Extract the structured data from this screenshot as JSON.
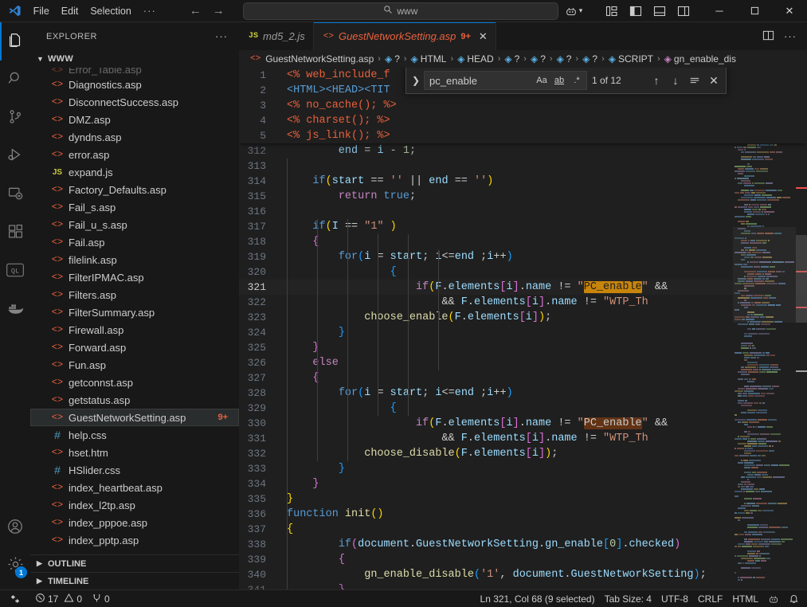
{
  "titlebar": {
    "menus": [
      "File",
      "Edit",
      "Selection"
    ],
    "more_label": "···",
    "back_icon": "arrow-left-icon",
    "forward_icon": "arrow-right-icon",
    "search_value": "www",
    "search_icon": "search-icon",
    "accounts_icon": "remote-explorer-icon",
    "layout_icons": [
      "customize-layout-icon",
      "toggle-primary-sidebar-icon",
      "toggle-panel-icon",
      "toggle-secondary-sidebar-icon"
    ],
    "minimize": "─",
    "maximize": "☐",
    "close": "✕"
  },
  "activitybar": {
    "items": [
      {
        "name": "explorer",
        "icon": "files-icon",
        "active": true
      },
      {
        "name": "search",
        "icon": "search-icon",
        "active": false
      },
      {
        "name": "source-control",
        "icon": "source-control-icon",
        "active": false
      },
      {
        "name": "run-debug",
        "icon": "run-and-debug-icon",
        "active": false
      },
      {
        "name": "remote-explorer",
        "icon": "remote-explorer-icon",
        "active": false
      },
      {
        "name": "extensions",
        "icon": "extensions-icon",
        "active": false
      },
      {
        "name": "codeql",
        "icon": "codeql-icon",
        "active": false
      },
      {
        "name": "docker",
        "icon": "docker-whale-icon",
        "active": false
      }
    ],
    "bottom": [
      {
        "name": "accounts",
        "icon": "account-icon",
        "badge": null
      },
      {
        "name": "settings",
        "icon": "gear-icon",
        "badge": "1"
      }
    ]
  },
  "sidebar": {
    "title": "EXPLORER",
    "more_actions": "···",
    "folder": "www",
    "files": [
      {
        "label": "Diagnostics.asp",
        "type": "asp"
      },
      {
        "label": "DisconnectSuccess.asp",
        "type": "asp"
      },
      {
        "label": "DMZ.asp",
        "type": "asp"
      },
      {
        "label": "dyndns.asp",
        "type": "asp"
      },
      {
        "label": "error.asp",
        "type": "asp"
      },
      {
        "label": "expand.js",
        "type": "js"
      },
      {
        "label": "Factory_Defaults.asp",
        "type": "asp"
      },
      {
        "label": "Fail_s.asp",
        "type": "asp"
      },
      {
        "label": "Fail_u_s.asp",
        "type": "asp"
      },
      {
        "label": "Fail.asp",
        "type": "asp"
      },
      {
        "label": "filelink.asp",
        "type": "asp"
      },
      {
        "label": "FilterIPMAC.asp",
        "type": "asp"
      },
      {
        "label": "Filters.asp",
        "type": "asp"
      },
      {
        "label": "FilterSummary.asp",
        "type": "asp"
      },
      {
        "label": "Firewall.asp",
        "type": "asp"
      },
      {
        "label": "Forward.asp",
        "type": "asp"
      },
      {
        "label": "Fun.asp",
        "type": "asp"
      },
      {
        "label": "getconnst.asp",
        "type": "asp"
      },
      {
        "label": "getstatus.asp",
        "type": "asp"
      },
      {
        "label": "GuestNetworkSetting.asp",
        "type": "asp",
        "selected": true,
        "badge": "9+"
      },
      {
        "label": "help.css",
        "type": "css"
      },
      {
        "label": "hset.htm",
        "type": "htm"
      },
      {
        "label": "HSlider.css",
        "type": "css"
      },
      {
        "label": "index_heartbeat.asp",
        "type": "asp"
      },
      {
        "label": "index_l2tp.asp",
        "type": "asp"
      },
      {
        "label": "index_pppoe.asp",
        "type": "asp"
      },
      {
        "label": "index_pptp.asp",
        "type": "asp"
      }
    ],
    "panels": [
      "OUTLINE",
      "TIMELINE"
    ]
  },
  "tabs": [
    {
      "label": "md5_2.js",
      "type": "js",
      "active": false
    },
    {
      "label": "GuestNetworkSetting.asp",
      "type": "asp",
      "active": true,
      "badge": "9+",
      "close": "✕"
    }
  ],
  "editor_actions": [
    "split-editor-icon",
    "more-actions-icon"
  ],
  "breadcrumbs": [
    {
      "label": "GuestNetworkSetting.asp",
      "icon": "asp-file-icon"
    },
    {
      "label": "?",
      "icon": "symbol-module-icon"
    },
    {
      "label": "HTML",
      "icon": "symbol-module-icon"
    },
    {
      "label": "HEAD",
      "icon": "symbol-module-icon"
    },
    {
      "label": "?",
      "icon": "symbol-module-icon"
    },
    {
      "label": "?",
      "icon": "symbol-module-icon"
    },
    {
      "label": "?",
      "icon": "symbol-module-icon"
    },
    {
      "label": "?",
      "icon": "symbol-module-icon"
    },
    {
      "label": "SCRIPT",
      "icon": "symbol-module-icon"
    },
    {
      "label": "gn_enable_dis",
      "icon": "symbol-method-icon"
    }
  ],
  "find": {
    "toggle_replace_icon": "chevron-right-icon",
    "query": "pc_enable",
    "match_case_label": "Aa",
    "whole_word_label": "ab",
    "regex_label": ".*",
    "results": "1 of 12",
    "prev_icon": "arrow-up-icon",
    "next_icon": "arrow-down-icon",
    "find_in_selection_icon": "selection-icon",
    "close_icon": "close-icon"
  },
  "sticky_lines": [
    {
      "num": "1",
      "html": "<span class='t-asp'>&lt;% web_include_f</span>"
    },
    {
      "num": "2",
      "html": "<span class='t-tag'>&lt;HTML&gt;&lt;HEAD&gt;&lt;TIT</span>"
    },
    {
      "num": "3",
      "html": "<span class='t-asp'>&lt;% no_cache(); %&gt;</span>"
    },
    {
      "num": "4",
      "html": "<span class='t-asp'>&lt;% charset(); %&gt;</span>"
    },
    {
      "num": "5",
      "html": "<span class='t-asp'>&lt;% js_link(); %&gt;</span>"
    }
  ],
  "code_lines": [
    {
      "num": "312",
      "clipped": true,
      "html": "<span class='t-var'>&nbsp;&nbsp;&nbsp;&nbsp;&nbsp;&nbsp;&nbsp;&nbsp;end</span> <span class='t-op'>=</span> <span class='t-var'>i</span> <span class='t-op'>-</span> <span class='t-num'>1</span><span class='t-op'>;</span>"
    },
    {
      "num": "313",
      "html": ""
    },
    {
      "num": "314",
      "html": "&nbsp;&nbsp;&nbsp;&nbsp;<span class='t-ctl'>if</span><span class='t-par'>(</span><span class='t-var'>start</span> <span class='t-op'>==</span> <span class='t-str'>''</span> <span class='t-op'>||</span> <span class='t-var'>end</span> <span class='t-op'>==</span> <span class='t-str'>''</span><span class='t-par'>)</span>"
    },
    {
      "num": "315",
      "html": "&nbsp;&nbsp;&nbsp;&nbsp;&nbsp;&nbsp;&nbsp;&nbsp;<span class='t-kw'>return</span> <span class='t-ctl'>true</span><span class='t-op'>;</span>"
    },
    {
      "num": "316",
      "html": ""
    },
    {
      "num": "317",
      "html": "&nbsp;&nbsp;&nbsp;&nbsp;<span class='t-ctl'>if</span><span class='t-par'>(</span><span class='t-var'>I</span> <span class='t-op'>==</span> <span class='t-str'>\"1\"</span> <span class='t-par'>)</span>"
    },
    {
      "num": "318",
      "html": "&nbsp;&nbsp;&nbsp;&nbsp;<span class='t-par2'>{</span>"
    },
    {
      "num": "319",
      "html": "&nbsp;&nbsp;&nbsp;&nbsp;&nbsp;&nbsp;&nbsp;&nbsp;<span class='t-ctl'>for</span><span class='t-par3'>(</span><span class='t-var'>i</span> <span class='t-op'>=</span> <span class='t-var'>start</span><span class='t-op'>;</span> <span class='t-var'>i</span><span class='t-op'>&lt;=</span><span class='t-var'>end</span> <span class='t-op'>;</span><span class='t-var'>i</span><span class='t-op'>++</span><span class='t-par3'>)</span>"
    },
    {
      "num": "320",
      "html": "&nbsp;&nbsp;&nbsp;&nbsp;&nbsp;&nbsp;&nbsp;&nbsp;&nbsp;&nbsp;&nbsp;&nbsp;&nbsp;&nbsp;&nbsp;&nbsp;<span class='t-par3'>{</span>"
    },
    {
      "num": "321",
      "current": true,
      "html": "&nbsp;&nbsp;&nbsp;&nbsp;&nbsp;&nbsp;&nbsp;&nbsp;&nbsp;&nbsp;&nbsp;&nbsp;&nbsp;&nbsp;&nbsp;&nbsp;&nbsp;&nbsp;&nbsp;&nbsp;<span class='t-kw'>if</span><span class='t-par'>(</span><span class='t-var'>F</span><span class='t-op'>.</span><span class='t-var'>elements</span><span class='t-par2'>[</span><span class='t-var'>i</span><span class='t-par2'>]</span><span class='t-op'>.</span><span class='t-var'>name</span> <span class='t-op'>!=</span> <span class='t-str'>\"</span><span class='hl-cur'>PC_enable</span><span class='t-str'>\"</span> <span class='t-op'>&amp;&amp;</span> "
    },
    {
      "num": "322",
      "html": "&nbsp;&nbsp;&nbsp;&nbsp;&nbsp;&nbsp;&nbsp;&nbsp;&nbsp;&nbsp;&nbsp;&nbsp;&nbsp;&nbsp;&nbsp;&nbsp;&nbsp;&nbsp;&nbsp;&nbsp;&nbsp;&nbsp;&nbsp;&nbsp;<span class='t-op'>&amp;&amp;</span> <span class='t-var'>F</span><span class='t-op'>.</span><span class='t-var'>elements</span><span class='t-par2'>[</span><span class='t-var'>i</span><span class='t-par2'>]</span><span class='t-op'>.</span><span class='t-var'>name</span> <span class='t-op'>!=</span> <span class='t-str'>\"WTP_Th</span>"
    },
    {
      "num": "323",
      "html": "&nbsp;&nbsp;&nbsp;&nbsp;&nbsp;&nbsp;&nbsp;&nbsp;&nbsp;&nbsp;&nbsp;&nbsp;<span class='t-fn'>choose_enable</span><span class='t-par'>(</span><span class='t-var'>F</span><span class='t-op'>.</span><span class='t-var'>elements</span><span class='t-par2'>[</span><span class='t-var'>i</span><span class='t-par2'>]</span><span class='t-par'>)</span><span class='t-op'>;</span>"
    },
    {
      "num": "324",
      "html": "&nbsp;&nbsp;&nbsp;&nbsp;&nbsp;&nbsp;&nbsp;&nbsp;<span class='t-par3'>}</span>"
    },
    {
      "num": "325",
      "html": "&nbsp;&nbsp;&nbsp;&nbsp;<span class='t-par2'>}</span>"
    },
    {
      "num": "326",
      "html": "&nbsp;&nbsp;&nbsp;&nbsp;<span class='t-kw'>else</span>"
    },
    {
      "num": "327",
      "html": "&nbsp;&nbsp;&nbsp;&nbsp;<span class='t-par2'>{</span>"
    },
    {
      "num": "328",
      "html": "&nbsp;&nbsp;&nbsp;&nbsp;&nbsp;&nbsp;&nbsp;&nbsp;<span class='t-ctl'>for</span><span class='t-par3'>(</span><span class='t-var'>i</span> <span class='t-op'>=</span> <span class='t-var'>start</span><span class='t-op'>;</span> <span class='t-var'>i</span><span class='t-op'>&lt;=</span><span class='t-var'>end</span> <span class='t-op'>;</span><span class='t-var'>i</span><span class='t-op'>++</span><span class='t-par3'>)</span>"
    },
    {
      "num": "329",
      "html": "&nbsp;&nbsp;&nbsp;&nbsp;&nbsp;&nbsp;&nbsp;&nbsp;&nbsp;&nbsp;&nbsp;&nbsp;&nbsp;&nbsp;&nbsp;&nbsp;<span class='t-par3'>{</span>"
    },
    {
      "num": "330",
      "html": "&nbsp;&nbsp;&nbsp;&nbsp;&nbsp;&nbsp;&nbsp;&nbsp;&nbsp;&nbsp;&nbsp;&nbsp;&nbsp;&nbsp;&nbsp;&nbsp;&nbsp;&nbsp;&nbsp;&nbsp;<span class='t-kw'>if</span><span class='t-par'>(</span><span class='t-var'>F</span><span class='t-op'>.</span><span class='t-var'>elements</span><span class='t-par2'>[</span><span class='t-var'>i</span><span class='t-par2'>]</span><span class='t-op'>.</span><span class='t-var'>name</span> <span class='t-op'>!=</span> <span class='t-str'>\"</span><span class='hl'>PC_enable</span><span class='t-str'>\"</span> <span class='t-op'>&amp;&amp;</span> "
    },
    {
      "num": "331",
      "html": "&nbsp;&nbsp;&nbsp;&nbsp;&nbsp;&nbsp;&nbsp;&nbsp;&nbsp;&nbsp;&nbsp;&nbsp;&nbsp;&nbsp;&nbsp;&nbsp;&nbsp;&nbsp;&nbsp;&nbsp;&nbsp;&nbsp;&nbsp;&nbsp;<span class='t-op'>&amp;&amp;</span> <span class='t-var'>F</span><span class='t-op'>.</span><span class='t-var'>elements</span><span class='t-par2'>[</span><span class='t-var'>i</span><span class='t-par2'>]</span><span class='t-op'>.</span><span class='t-var'>name</span> <span class='t-op'>!=</span> <span class='t-str'>\"WTP_Th</span>"
    },
    {
      "num": "332",
      "html": "&nbsp;&nbsp;&nbsp;&nbsp;&nbsp;&nbsp;&nbsp;&nbsp;&nbsp;&nbsp;&nbsp;&nbsp;<span class='t-fn'>choose_disable</span><span class='t-par'>(</span><span class='t-var'>F</span><span class='t-op'>.</span><span class='t-var'>elements</span><span class='t-par2'>[</span><span class='t-var'>i</span><span class='t-par2'>]</span><span class='t-par'>)</span><span class='t-op'>;</span>"
    },
    {
      "num": "333",
      "html": "&nbsp;&nbsp;&nbsp;&nbsp;&nbsp;&nbsp;&nbsp;&nbsp;<span class='t-par3'>}</span>"
    },
    {
      "num": "334",
      "html": "&nbsp;&nbsp;&nbsp;&nbsp;<span class='t-par2'>}</span>"
    },
    {
      "num": "335",
      "html": "<span class='t-par'>}</span>"
    },
    {
      "num": "336",
      "html": "<span class='t-ctl'>function</span> <span class='t-fn'>init</span><span class='t-par'>()</span>"
    },
    {
      "num": "337",
      "html": "<span class='t-par'>{</span>"
    },
    {
      "num": "338",
      "html": "&nbsp;&nbsp;&nbsp;&nbsp;&nbsp;&nbsp;&nbsp;&nbsp;<span class='t-ctl'>if</span><span class='t-par2'>(</span><span class='t-var'>document</span><span class='t-op'>.</span><span class='t-var'>GuestNetworkSetting</span><span class='t-op'>.</span><span class='t-var'>gn_enable</span><span class='t-par3'>[</span><span class='t-num'>0</span><span class='t-par3'>]</span><span class='t-op'>.</span><span class='t-var'>checked</span><span class='t-par2'>)</span>"
    },
    {
      "num": "339",
      "html": "&nbsp;&nbsp;&nbsp;&nbsp;&nbsp;&nbsp;&nbsp;&nbsp;<span class='t-par2'>{</span>"
    },
    {
      "num": "340",
      "html": "&nbsp;&nbsp;&nbsp;&nbsp;&nbsp;&nbsp;&nbsp;&nbsp;&nbsp;&nbsp;&nbsp;&nbsp;<span class='t-fn'>gn_enable_disable</span><span class='t-par3'>(</span><span class='t-str'>'1'</span><span class='t-op'>,</span> <span class='t-var'>document</span><span class='t-op'>.</span><span class='t-var'>GuestNetworkSetting</span><span class='t-par3'>)</span><span class='t-op'>;</span>"
    },
    {
      "num": "341",
      "clipped": true,
      "html": "&nbsp;&nbsp;&nbsp;&nbsp;&nbsp;&nbsp;&nbsp;&nbsp;<span class='t-par2'>}</span>"
    }
  ],
  "statusbar": {
    "remote_icon": "remote-window-icon",
    "errors_icon": "error-icon",
    "errors": "17",
    "warnings_icon": "warning-icon",
    "warnings": "0",
    "ports_icon": "ports-icon",
    "ports": "0",
    "cursor": "Ln 321, Col 68 (9 selected)",
    "tab_size": "Tab Size: 4",
    "encoding": "UTF-8",
    "eol": "CRLF",
    "language": "HTML",
    "feedback_icon": "smiley-icon",
    "bell_icon": "bell-icon"
  },
  "colors": {
    "accent": "#0078d4",
    "asp_orange": "#e8603c",
    "current_match": "#c8850c",
    "other_match": "#623315"
  }
}
